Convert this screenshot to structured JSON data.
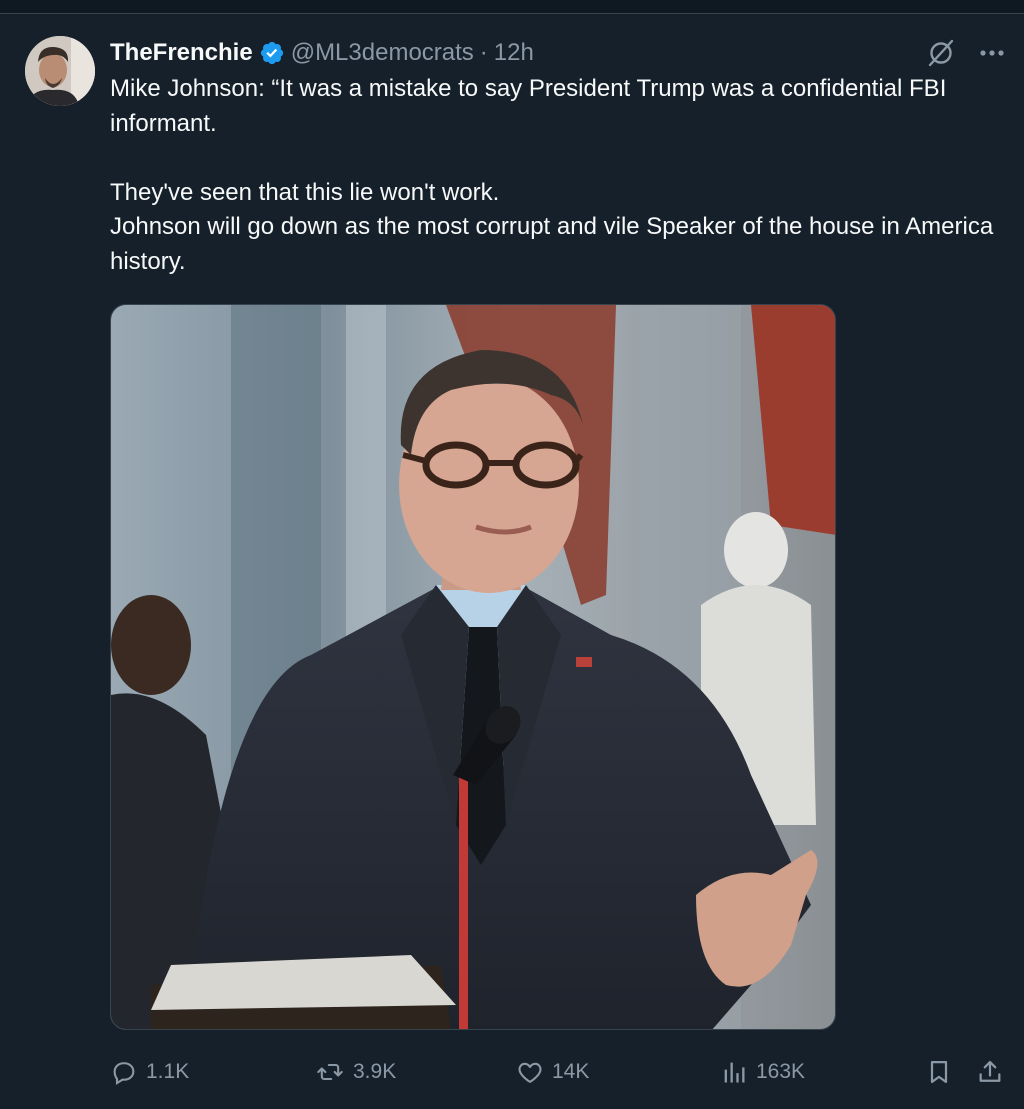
{
  "author": {
    "display_name": "TheFrenchie",
    "handle": "@ML3democrats",
    "separator": "·",
    "time": "12h",
    "verified": true
  },
  "tweet": {
    "paragraphs": [
      "Mike Johnson: “It was a mistake to say President Trump was a confidential FBI informant.",
      "They've seen that this lie won't work.",
      "Johnson will go down as the most corrupt and vile Speaker of the house in America history."
    ]
  },
  "media": {
    "icon": "photo"
  },
  "actions": {
    "reply_count": "1.1K",
    "retweet_count": "3.9K",
    "like_count": "14K",
    "views_count": "163K"
  },
  "colors": {
    "background": "#15202b",
    "text": "#f7f9f9",
    "muted": "#8b98a5",
    "verified": "#1d9bf0"
  },
  "icons": {
    "grok": "grok-slash-icon",
    "more": "more-dots-icon",
    "reply": "reply-bubble-icon",
    "retweet": "retweet-icon",
    "like": "heart-icon",
    "views": "bar-chart-icon",
    "bookmark": "bookmark-icon",
    "share": "share-icon"
  }
}
